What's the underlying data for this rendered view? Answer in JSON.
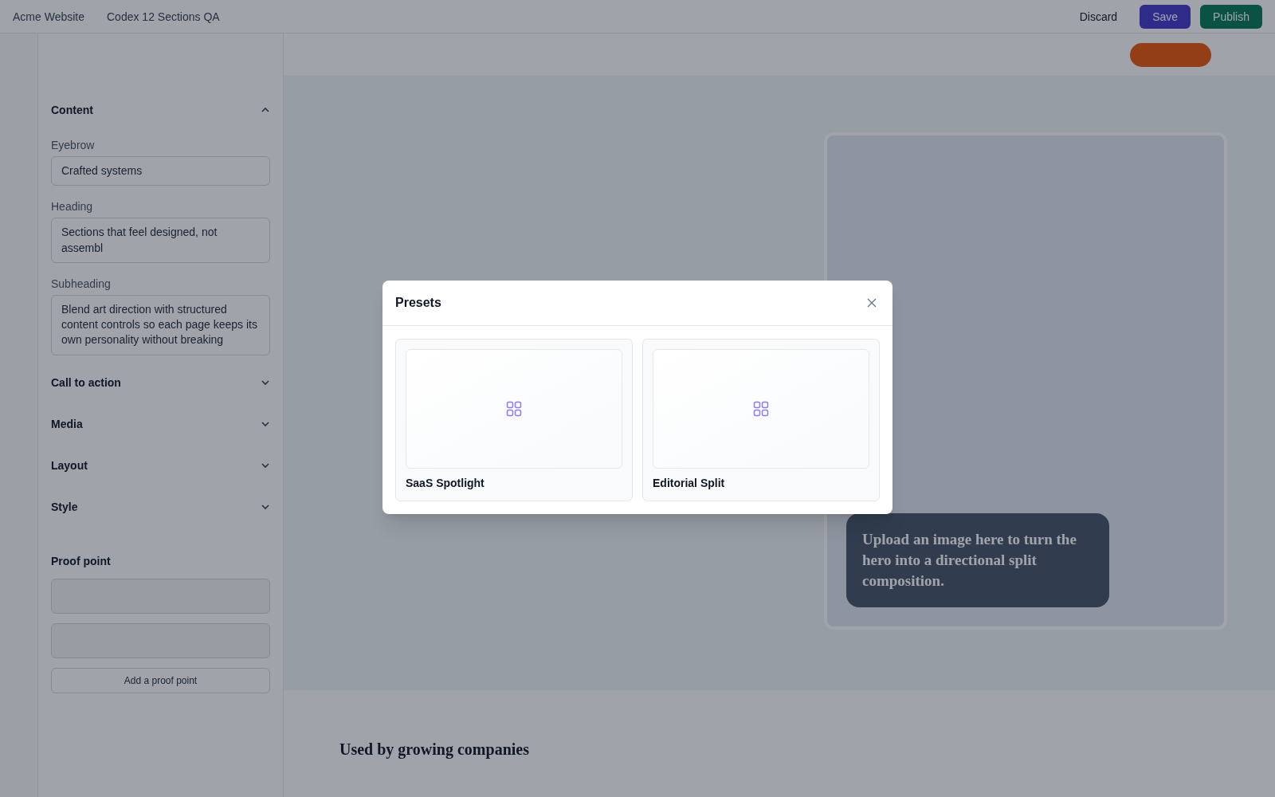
{
  "topbar": {
    "site": "Acme Website",
    "page": "Codex 12 Sections QA",
    "buttons": [
      {
        "label": "Discard",
        "kind": "plain"
      },
      {
        "label": "Save",
        "kind": "primary"
      },
      {
        "label": "Publish",
        "kind": "success"
      }
    ]
  },
  "sidebar": {
    "sections": [
      {
        "title": "Content",
        "expanded": true
      },
      {
        "title": "Call to action",
        "expanded": false
      },
      {
        "title": "Media",
        "expanded": false
      },
      {
        "title": "Layout",
        "expanded": false
      },
      {
        "title": "Style",
        "expanded": false
      }
    ],
    "fields": [
      {
        "label": "Eyebrow",
        "value": "Crafted systems"
      },
      {
        "label": "Heading",
        "value": "Sections that feel designed, not assembl"
      },
      {
        "label": "Subheading",
        "value": "Blend art direction with structured content controls so each page keeps its own personality without breaking"
      }
    ],
    "proof_title": "Proof point",
    "add_label": "Add a proof point"
  },
  "canvas": {
    "caption": "Upload an image here to turn the hero into a directional split composition.",
    "logos_heading": "Used by growing companies"
  },
  "dialog": {
    "title": "Presets",
    "presets": [
      {
        "name": "SaaS Spotlight"
      },
      {
        "name": "Editorial Split"
      }
    ]
  }
}
